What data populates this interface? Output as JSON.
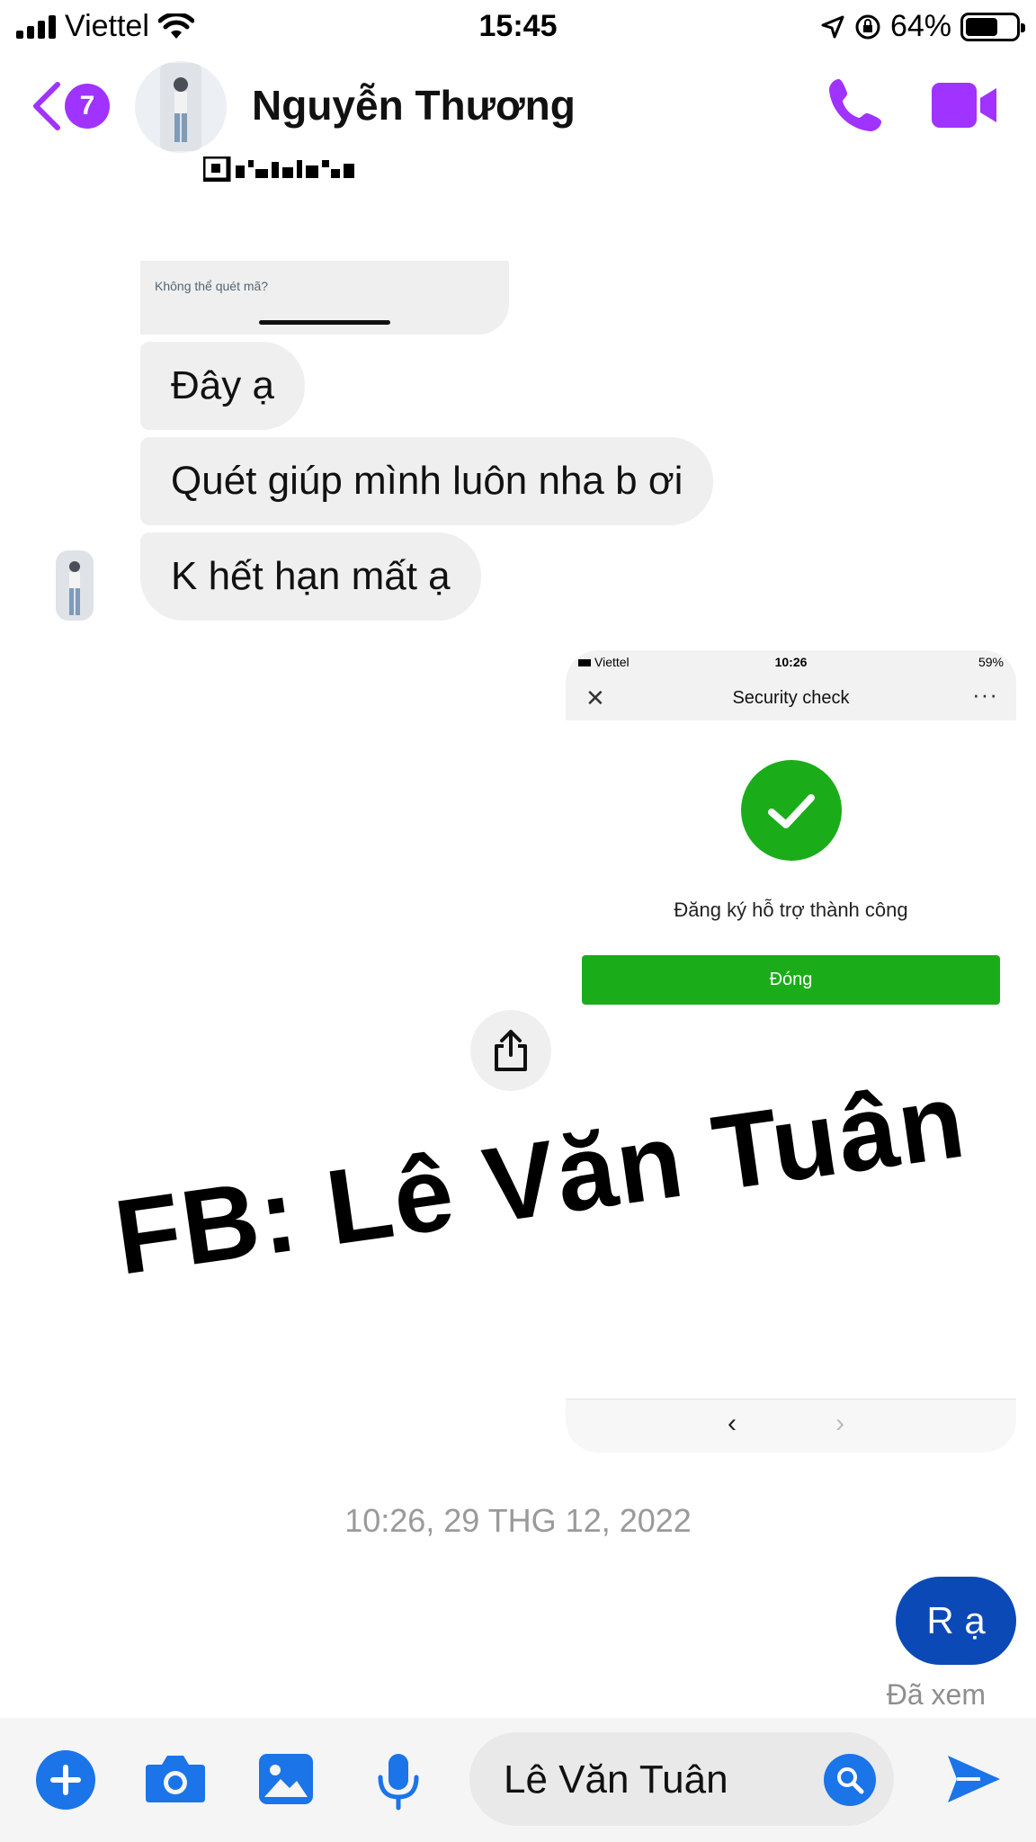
{
  "status_bar": {
    "carrier": "Viettel",
    "time": "15:45",
    "battery": "64%",
    "battery_level": 0.64
  },
  "header": {
    "back_badge": "7",
    "contact_name": "Nguyễn Thương",
    "accent_color": "#a033ff"
  },
  "messages": {
    "received_image_caption": "Không thể quét mã?",
    "received": [
      "Đây ạ",
      "Quét giúp mình luôn nha b ơi",
      "K hết hạn mất ạ"
    ],
    "sent_screenshot": {
      "carrier": "Viettel",
      "time": "10:26",
      "battery": "59%",
      "title": "Security check",
      "success_text": "Đăng ký hỗ trợ thành công",
      "close_label": "Đóng",
      "success_color": "#1aad19"
    },
    "timestamp": "10:26, 29 THG 12, 2022",
    "sent_text": "R ạ",
    "seen_status": "Đã xem"
  },
  "watermark": "FB: Lê Văn Tuân",
  "composer": {
    "input_value": "Lê Văn Tuân",
    "accent_color": "#1b74e8"
  }
}
